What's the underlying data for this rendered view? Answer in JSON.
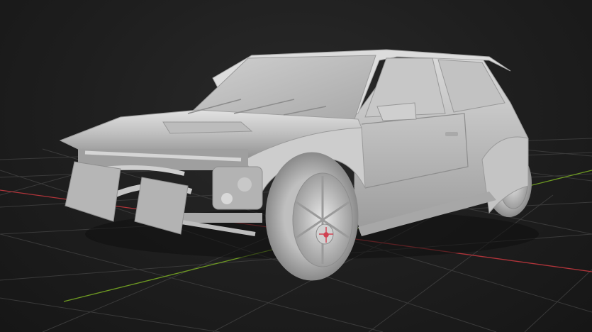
{
  "viewport": {
    "mode": "3d-viewport",
    "background_color": "#1e1e1e",
    "grid": {
      "visible": true,
      "line_color": "#3a3a3a"
    },
    "axes": {
      "x_color": "#c0393b",
      "y_color": "#7aa526"
    }
  },
  "scene": {
    "object": "car-model",
    "description_visible": false,
    "material_color": "#c9c9c9"
  },
  "gizmo": {
    "type": "object-origin",
    "color": "#d04050"
  }
}
